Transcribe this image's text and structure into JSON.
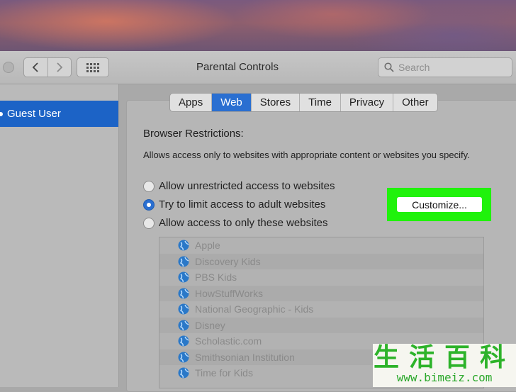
{
  "window": {
    "title": "Parental Controls",
    "search_placeholder": "Search"
  },
  "sidebar": {
    "items": [
      {
        "label": "Guest User",
        "selected": true
      }
    ]
  },
  "tabs": [
    {
      "label": "Apps",
      "active": false
    },
    {
      "label": "Web",
      "active": true
    },
    {
      "label": "Stores",
      "active": false
    },
    {
      "label": "Time",
      "active": false
    },
    {
      "label": "Privacy",
      "active": false
    },
    {
      "label": "Other",
      "active": false
    }
  ],
  "content": {
    "heading": "Browser Restrictions:",
    "description": "Allows access only to websites with appropriate content or websites you specify.",
    "options": [
      {
        "label": "Allow unrestricted access to websites",
        "selected": false
      },
      {
        "label": "Try to limit access to adult websites",
        "selected": true
      },
      {
        "label": "Allow access to only these websites",
        "selected": false
      }
    ],
    "customize_button": "Customize...",
    "sites": [
      "Apple",
      "Discovery Kids",
      "PBS Kids",
      "HowStuffWorks",
      "National Geographic - Kids",
      "Disney",
      "Scholastic.com",
      "Smithsonian Institution",
      "Time for Kids"
    ]
  },
  "watermark": {
    "chinese": "生活百科",
    "url": "www.bimeiz.com"
  },
  "colors": {
    "accent": "#2a6fd1",
    "highlight": "#20f20c",
    "sidebar_selected": "#1c63c6"
  }
}
